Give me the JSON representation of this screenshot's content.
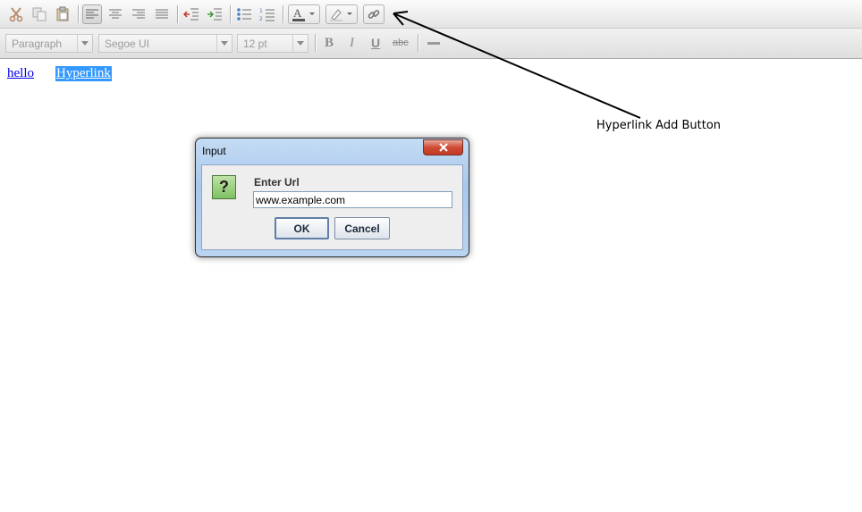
{
  "toolbar": {
    "paragraph_combo": "Paragraph",
    "font_combo": "Segoe UI",
    "size_combo": "12 pt",
    "bold": "B",
    "italic": "I",
    "underline": "U",
    "strike": "abc"
  },
  "editor": {
    "link1": "hello",
    "link2": "Hyperlink"
  },
  "annotation": {
    "label": "Hyperlink Add Button"
  },
  "dialog": {
    "title": "Input",
    "icon_glyph": "?",
    "prompt": "Enter Url",
    "url_value": "www.example.com",
    "ok_label": "OK",
    "cancel_label": "Cancel"
  },
  "colors": {
    "selection": "#3399ff",
    "link": "#0000ee",
    "close_button": "#cf4a35"
  }
}
